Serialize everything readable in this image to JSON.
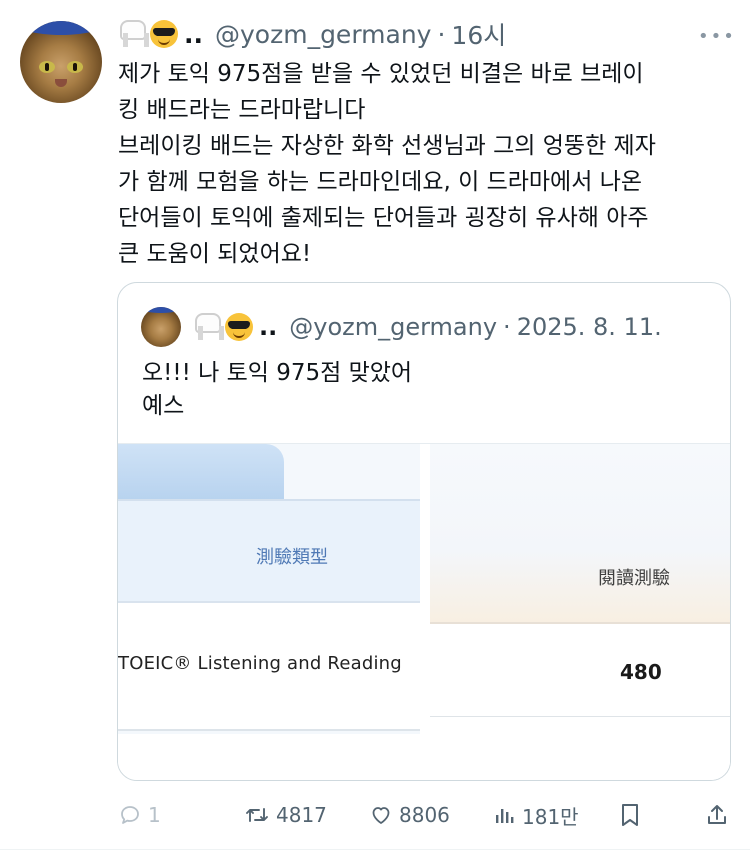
{
  "tweet": {
    "author_handle": "@yozm_germany",
    "separator": "·",
    "time": "16시",
    "name_trailing": "..",
    "more_label": "•••",
    "text_lines": [
      "제가 토익 975점을 받을 수 있었던 비결은 바로 브레이",
      "킹 배드라는 드라마랍니다",
      "브레이킹 배드는 자상한 화학 선생님과 그의 엉뚱한 제자",
      "가 함께 모험을 하는 드라마인데요, 이 드라마에서 나온",
      "단어들이 토익에 출제되는 단어들과 굉장히 유사해 아주",
      "큰 도움이 되었어요!"
    ]
  },
  "quote": {
    "name_trailing": "..",
    "author_handle": "@yozm_germany",
    "separator": "·",
    "date": "2025. 8. 11.",
    "text_lines": [
      "오!!! 나 토익 975점 맞았어",
      "예스"
    ],
    "media": {
      "left_header": "測驗類型",
      "left_row": "TOEIC® Listening and Reading",
      "right_header": "閱讀測驗",
      "right_value": "480"
    }
  },
  "actions": {
    "reply_count": "1",
    "retweet_count": "4817",
    "like_count": "8806",
    "views_count": "181만"
  },
  "icons": {
    "emoji_1": "tooth-emoji",
    "emoji_2": "sunglasses-emoji",
    "reply": "reply-icon",
    "retweet": "retweet-icon",
    "like": "heart-icon",
    "views": "views-icon",
    "bookmark": "bookmark-icon",
    "share": "share-icon"
  }
}
